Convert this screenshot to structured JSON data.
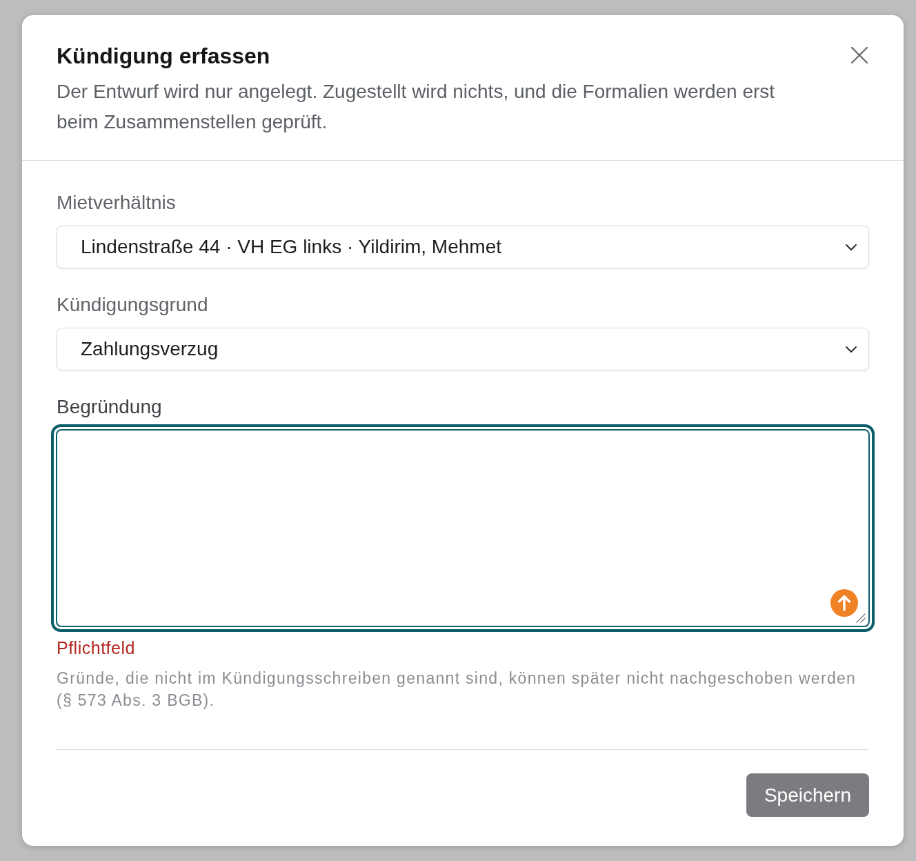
{
  "dialog": {
    "title": "Kündigung erfassen",
    "description": "Der Entwurf wird nur angelegt. Zugestellt wird nichts, und die Formalien werden erst beim Zusammenstellen geprüft."
  },
  "fields": [
    {
      "kind": "select",
      "label": "Mietverhältnis",
      "value": "Lindenstraße 44 · VH EG links · Yildirim, Mehmet"
    },
    {
      "kind": "select",
      "label": "Kündigungsgrund",
      "value": "Zahlungsverzug"
    },
    {
      "kind": "textarea",
      "label": "Begründung",
      "focused": true,
      "error": "Pflichtfeld",
      "help": "Gründe, die nicht im Kündigungsschreiben genannt sind, können später nicht nachgeschoben werden (§ 573 Abs. 3 BGB)."
    }
  ],
  "footer": {
    "buttons": [
      {
        "label": "Speichern",
        "disabled": true
      }
    ]
  }
}
